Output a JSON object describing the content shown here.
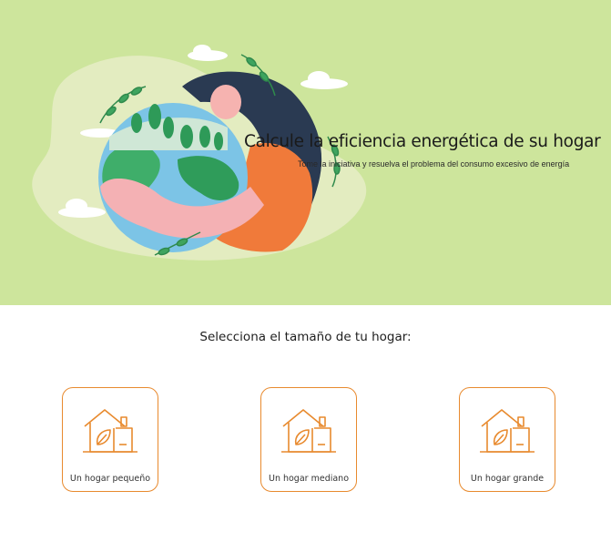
{
  "hero": {
    "title": "Calcule la eficiencia energética de su hogar",
    "subtitle": "Tome la iniciativa y resuelva el problema del consumo excesivo de energía",
    "background": "#cde59c"
  },
  "selection": {
    "prompt": "Selecciona el tamaño de tu hogar:",
    "accent": "#e88a2e",
    "options": [
      {
        "label": "Un hogar pequeño",
        "icon": "eco-house-icon"
      },
      {
        "label": "Un hogar mediano",
        "icon": "eco-house-icon"
      },
      {
        "label": "Un hogar grande",
        "icon": "eco-house-icon"
      }
    ]
  }
}
